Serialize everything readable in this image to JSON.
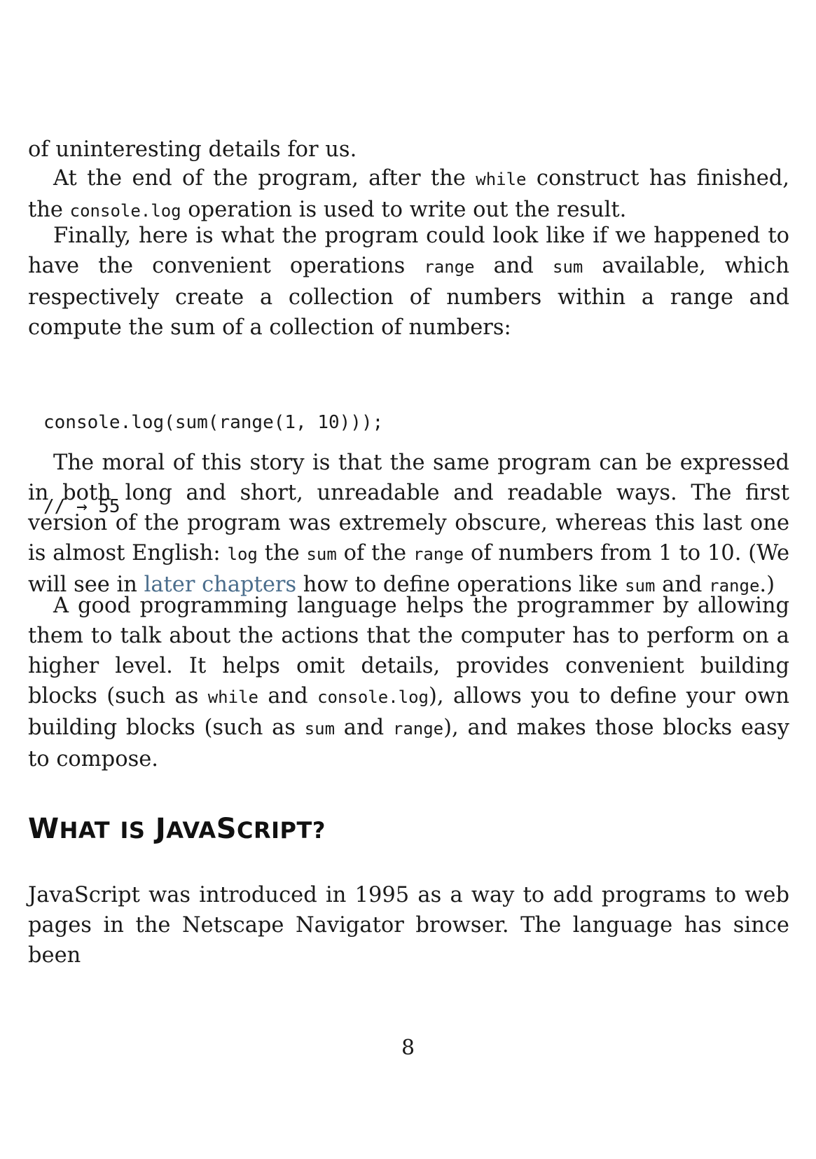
{
  "paragraphs": {
    "p1": {
      "text": "of uninteresting details for us."
    },
    "p2": {
      "t1": "At the end of the program, after the ",
      "c1": "while",
      "t2": " construct has finished, the ",
      "c2": "console.log",
      "t3": " operation is used to write out the result."
    },
    "p3": {
      "t1": "Finally, here is what the program could look like if we happened to have the convenient operations ",
      "c1": "range",
      "t2": " and ",
      "c2": "sum",
      "t3": " available, which respectively create a collection of numbers within a range and compute the sum of a collection of numbers:"
    },
    "p4": {
      "t1": "The moral of this story is that the same program can be expressed in both long and short, unreadable and readable ways. The first version of the program was extremely obscure, whereas this last one is almost English: ",
      "c1": "log",
      "t2": " the ",
      "c2": "sum",
      "t3": " of the ",
      "c3": "range",
      "t4": " of numbers from 1 to 10. (We will see in ",
      "link": "later chapters",
      "t5": " how to define operations like ",
      "c4": "sum",
      "t6": " and ",
      "c5": "range",
      "t7": ".)"
    },
    "p5": {
      "t1": "A good programming language helps the programmer by allowing them to talk about the actions that the computer has to perform on a higher level. It helps omit details, provides convenient building blocks (such as ",
      "c1": "while",
      "t2": " and ",
      "c2": "console.log",
      "t3": "), allows you to define your own building blocks (such as ",
      "c3": "sum",
      "t4": " and ",
      "c4": "range",
      "t5": "), and makes those blocks easy to compose."
    },
    "p6": {
      "text": "JavaScript was introduced in 1995 as a way to add programs to web pages in the Netscape Navigator browser. The language has since been"
    }
  },
  "code_block": {
    "line1": "console.log(sum(range(1, 10)));",
    "line2": "// → 55"
  },
  "heading": {
    "w1_cap": "W",
    "w1_rest": "HAT",
    "w2": "IS",
    "w3_cap": "J",
    "w3_mid": "AVA",
    "w3_cap2": "S",
    "w3_rest": "CRIPT?"
  },
  "page_number": "8"
}
